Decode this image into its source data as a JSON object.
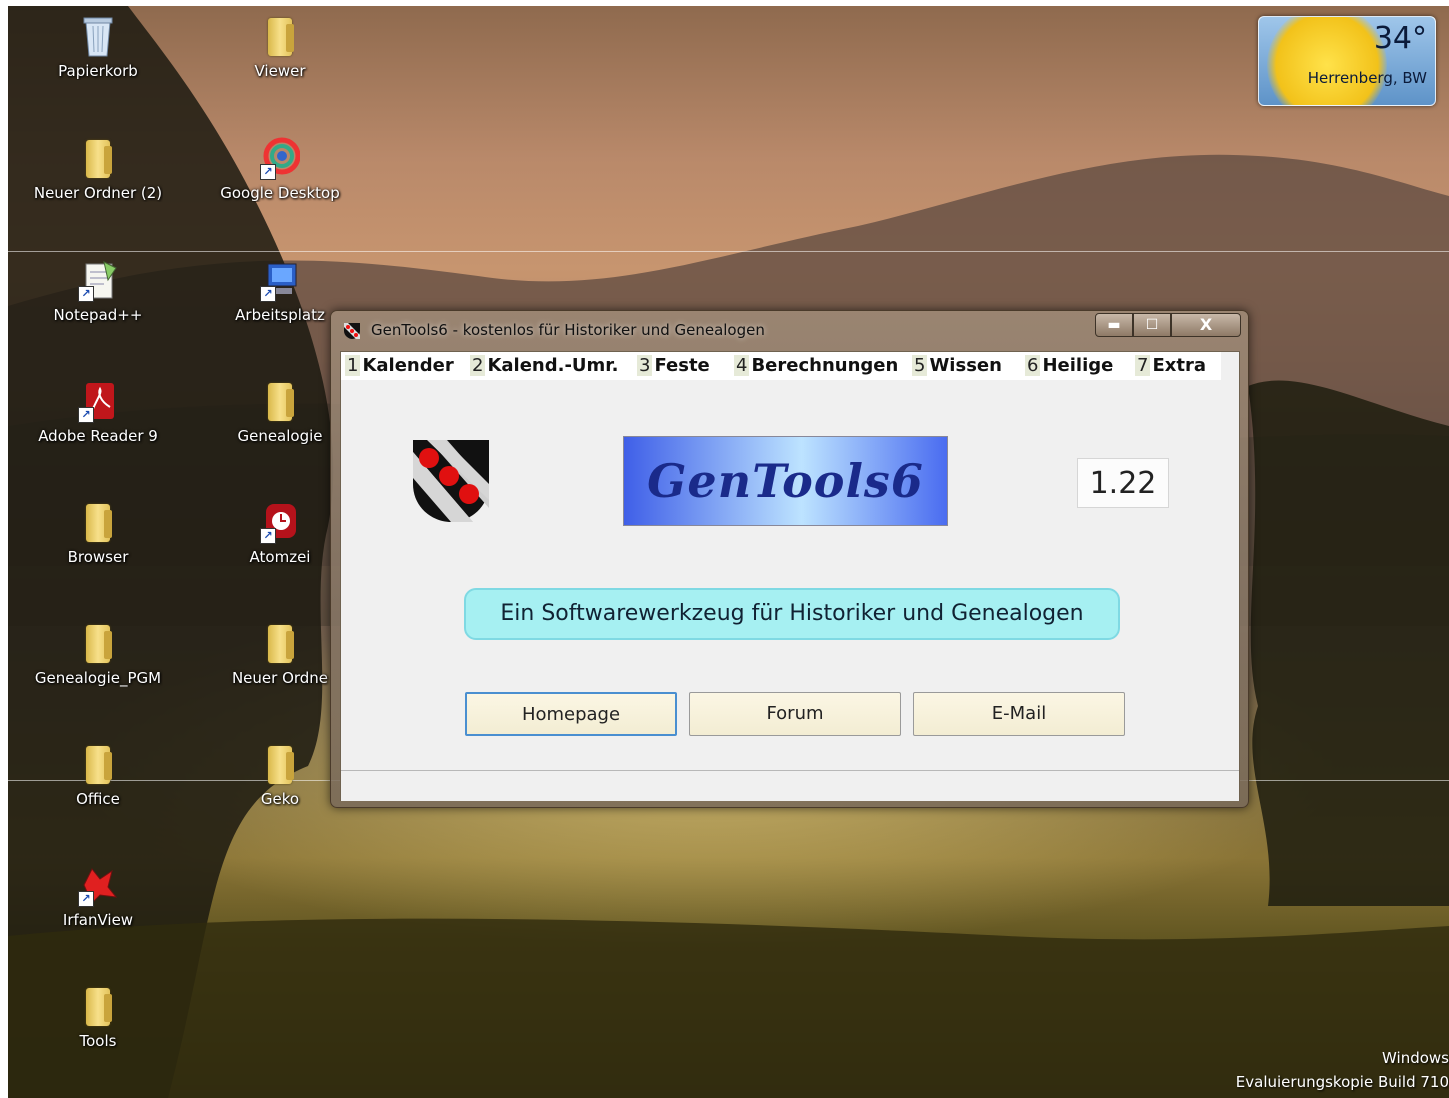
{
  "desktop": {
    "icons": [
      {
        "label": "Papierkorb",
        "icon": "recycle-bin-icon"
      },
      {
        "label": "Viewer",
        "icon": "folder-icon"
      },
      {
        "label": "Neuer Ordner (2)",
        "icon": "folder-icon"
      },
      {
        "label": "Google Desktop",
        "icon": "google-desktop-icon"
      },
      {
        "label": "Notepad++",
        "icon": "notepad-plus-plus-icon"
      },
      {
        "label": "Arbeitsplatz",
        "icon": "computer-icon"
      },
      {
        "label": "Adobe Reader 9",
        "icon": "adobe-reader-icon"
      },
      {
        "label": "Genealogie",
        "icon": "folder-icon"
      },
      {
        "label": "Browser",
        "icon": "folder-icon"
      },
      {
        "label": "Atomzei",
        "icon": "atomzeit-icon"
      },
      {
        "label": "Genealogie_PGM",
        "icon": "folder-icon"
      },
      {
        "label": "Neuer Ordne",
        "icon": "folder-icon"
      },
      {
        "label": "Office",
        "icon": "folder-icon"
      },
      {
        "label": "Geko",
        "icon": "folder-icon"
      },
      {
        "label": "IrfanView",
        "icon": "irfanview-icon"
      },
      {
        "label": "Tools",
        "icon": "folder-icon"
      }
    ],
    "weather": {
      "temperature": "34°",
      "location": "Herrenberg, BW"
    },
    "watermark": {
      "line1": "Windows",
      "line2": "Evaluierungskopie Build 710"
    }
  },
  "window": {
    "title": "GenTools6 - kostenlos für Historiker und Genealogen",
    "caption_buttons": {
      "minimize": "▬",
      "maximize": "☐",
      "close": "X"
    },
    "tabs": [
      {
        "num": "1",
        "label": "Kalender"
      },
      {
        "num": "2",
        "label": "Kalend.-Umr."
      },
      {
        "num": "3",
        "label": "Feste"
      },
      {
        "num": "4",
        "label": "Berechnungen"
      },
      {
        "num": "5",
        "label": "Wissen"
      },
      {
        "num": "6",
        "label": "Heilige"
      },
      {
        "num": "7",
        "label": "Extra"
      }
    ],
    "logo_text": "GenTools6",
    "version": "1.22",
    "tagline": "Ein Softwarewerkzeug für Historiker und Genealogen",
    "buttons": {
      "homepage": "Homepage",
      "forum": "Forum",
      "email": "E-Mail"
    }
  }
}
